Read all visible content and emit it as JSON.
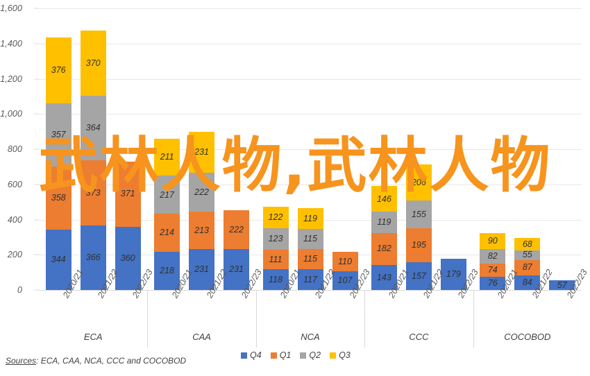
{
  "watermark": {
    "text": "武林人物,武林人物"
  },
  "source": {
    "prefix": "Sources",
    "separator": ": ",
    "text": "ECA, CAA, NCA, CCC and COCOBOD"
  },
  "legend": {
    "position": "bottom-center",
    "items": [
      {
        "label": "Q4",
        "color": "#4472c4"
      },
      {
        "label": "Q1",
        "color": "#ed7d31"
      },
      {
        "label": "Q2",
        "color": "#a5a5a5"
      },
      {
        "label": "Q3",
        "color": "#ffc000"
      }
    ]
  },
  "axis": {
    "y_ticks": [
      "0",
      "200",
      "400",
      "600",
      "800",
      "1,000",
      "1,200",
      "1,400",
      "1,600"
    ],
    "groups": [
      "ECA",
      "CAA",
      "NCA",
      "CCC",
      "COCOBOD"
    ],
    "periods": [
      "2020/21",
      "2021/22",
      "2022/23"
    ]
  },
  "chart_data": {
    "type": "bar",
    "subtype": "stacked-grouped-column",
    "title": "",
    "subtitle": "",
    "xlabel": "",
    "ylabel": "",
    "ylim": [
      0,
      1600
    ],
    "ytick_step": 200,
    "grid": true,
    "legend_position": "bottom-center",
    "colors": {
      "Q4": "#4472c4",
      "Q1": "#ed7d31",
      "Q2": "#a5a5a5",
      "Q3": "#ffc000"
    },
    "series": [
      {
        "name": "Q4",
        "color": "#4472c4"
      },
      {
        "name": "Q1",
        "color": "#ed7d31"
      },
      {
        "name": "Q2",
        "color": "#a5a5a5"
      },
      {
        "name": "Q3",
        "color": "#ffc000"
      }
    ],
    "groups": [
      {
        "name": "ECA",
        "bars": [
          {
            "category": "2020/21",
            "values": {
              "Q4": 344,
              "Q1": 358,
              "Q2": 357,
              "Q3": 376
            },
            "total": 1435
          },
          {
            "category": "2021/22",
            "values": {
              "Q4": 366,
              "Q1": 373,
              "Q2": 364,
              "Q3": 370
            },
            "total": 1473
          },
          {
            "category": "2022/23",
            "values": {
              "Q4": 360,
              "Q1": 371,
              "Q2": null,
              "Q3": null
            },
            "total": 731
          }
        ]
      },
      {
        "name": "CAA",
        "bars": [
          {
            "category": "2020/21",
            "values": {
              "Q4": 218,
              "Q1": 214,
              "Q2": 217,
              "Q3": 211
            },
            "total": 860
          },
          {
            "category": "2021/22",
            "values": {
              "Q4": 231,
              "Q1": 213,
              "Q2": 222,
              "Q3": 231
            },
            "total": 897
          },
          {
            "category": "2022/23",
            "values": {
              "Q4": 231,
              "Q1": 222,
              "Q2": null,
              "Q3": null
            },
            "total": 453
          }
        ]
      },
      {
        "name": "NCA",
        "bars": [
          {
            "category": "2020/21",
            "values": {
              "Q4": 118,
              "Q1": 111,
              "Q2": 123,
              "Q3": 122
            },
            "total": 474
          },
          {
            "category": "2021/22",
            "values": {
              "Q4": 117,
              "Q1": 115,
              "Q2": 115,
              "Q3": 119
            },
            "total": 466
          },
          {
            "category": "2022/23",
            "values": {
              "Q4": 107,
              "Q1": 110,
              "Q2": null,
              "Q3": null
            },
            "total": 217
          }
        ]
      },
      {
        "name": "CCC",
        "bars": [
          {
            "category": "2020/21",
            "values": {
              "Q4": 143,
              "Q1": 182,
              "Q2": 119,
              "Q3": 146
            },
            "total": 590
          },
          {
            "category": "2021/22",
            "values": {
              "Q4": 157,
              "Q1": 195,
              "Q2": 155,
              "Q3": 206
            },
            "total": 713
          },
          {
            "category": "2022/23",
            "values": {
              "Q4": 179,
              "Q1": null,
              "Q2": null,
              "Q3": null
            },
            "total": 179
          }
        ]
      },
      {
        "name": "COCOBOD",
        "bars": [
          {
            "category": "2020/21",
            "values": {
              "Q4": 76,
              "Q1": 74,
              "Q2": 82,
              "Q3": 90
            },
            "total": 322
          },
          {
            "category": "2021/22",
            "values": {
              "Q4": 84,
              "Q1": 87,
              "Q2": 55,
              "Q3": 68
            },
            "total": 294
          },
          {
            "category": "2022/23",
            "values": {
              "Q4": 57,
              "Q1": null,
              "Q2": null,
              "Q3": null
            },
            "total": 57
          }
        ]
      }
    ]
  }
}
